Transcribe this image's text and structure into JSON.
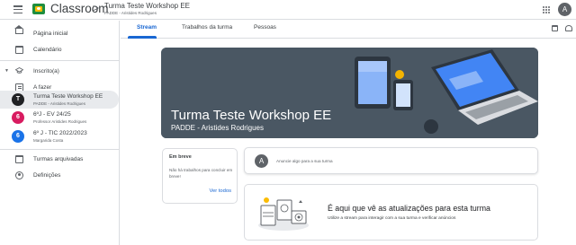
{
  "app": {
    "name": "Classroom",
    "breadcrumb_sep": ">",
    "course_title": "Turma Teste Workshop EE",
    "course_subtitle": "PADDE - Aristides Rodrigues",
    "account_initial": "A"
  },
  "sidebar": {
    "home": "Página inicial",
    "calendar": "Calendário",
    "enrolled": "Inscrito(a)",
    "todo": "A fazer",
    "classes": [
      {
        "initial": "T",
        "name": "Turma Teste Workshop EE",
        "sub": "PADDE - Aristides Rodrigues",
        "color": "#202124",
        "selected": true
      },
      {
        "initial": "6",
        "name": "6ºJ - EV 24/25",
        "sub": "Professor Aristides Rodrigues",
        "color": "#d81b60",
        "selected": false
      },
      {
        "initial": "6",
        "name": "6º J - TIC 2022/2023",
        "sub": "Margarida Costa",
        "color": "#1a73e8",
        "selected": false
      }
    ],
    "archived": "Turmas arquivadas",
    "settings": "Definições"
  },
  "tabs": {
    "stream": "Stream",
    "classwork": "Trabalhos da turma",
    "people": "Pessoas"
  },
  "banner": {
    "title": "Turma Teste Workshop EE",
    "subtitle": "PADDE - Aristides Rodrigues"
  },
  "upcoming": {
    "title": "Em breve",
    "text": "Não há trabalhos para concluir em breve!",
    "link": "Ver todos"
  },
  "announce": {
    "avatar": "A",
    "placeholder": "Anuncie algo para a sua turma"
  },
  "empty_state": {
    "title": "É aqui que vê as atualizações para esta turma",
    "subtitle": "Utilize a stream para interagir com a sua turma e verificar anúncios"
  },
  "colors": {
    "accent": "#1967d2",
    "banner_bg": "#4a5763",
    "selected_bg": "#e8eaed"
  }
}
